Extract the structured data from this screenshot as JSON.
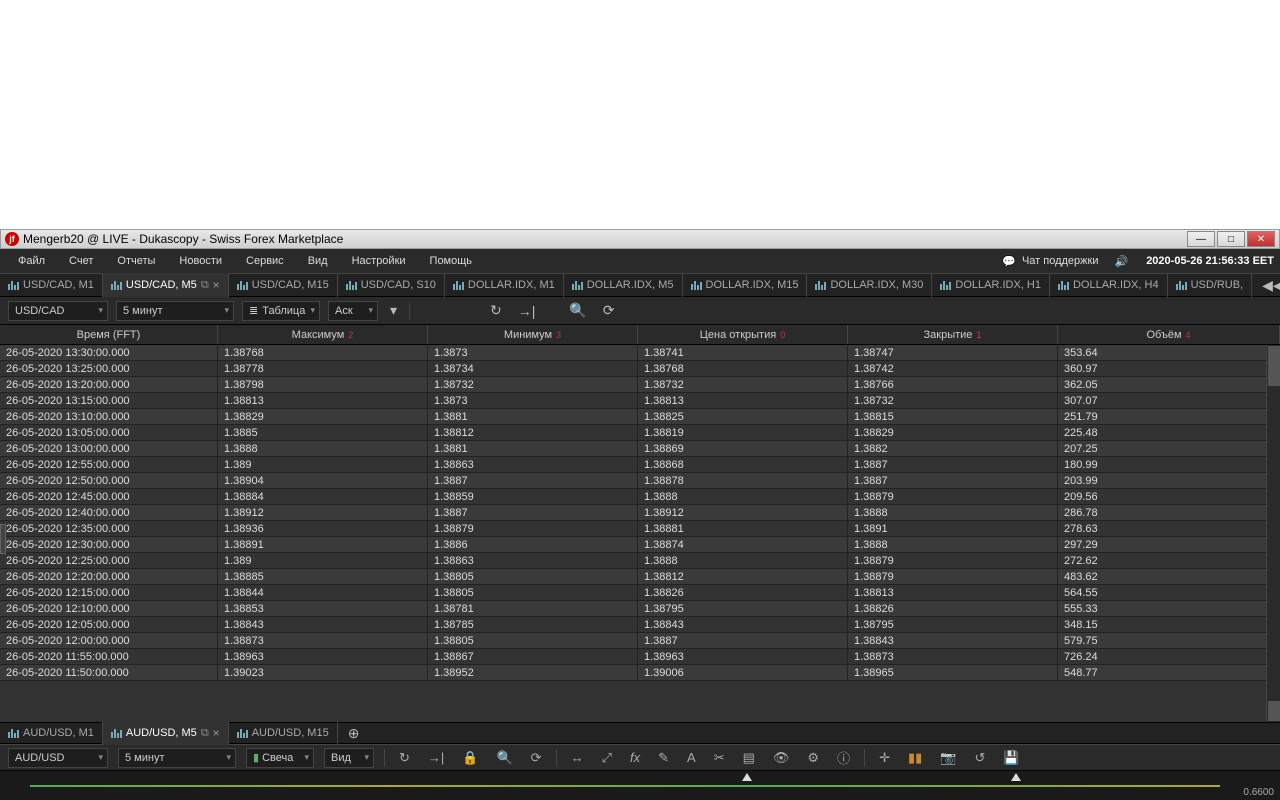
{
  "window": {
    "title": "Mengerb20 @ LIVE - Dukascopy - Swiss Forex Marketplace"
  },
  "menubar": {
    "items": [
      "Файл",
      "Счет",
      "Отчеты",
      "Новости",
      "Сервис",
      "Вид",
      "Настройки",
      "Помощь"
    ],
    "chat": "Чат поддержки",
    "clock": "2020-05-26 21:56:33 EET"
  },
  "tabs_top": [
    {
      "label": "USD/CAD, M1",
      "active": false,
      "icon": false
    },
    {
      "label": "USD/CAD, M5",
      "active": true,
      "icon": true,
      "closable": true
    },
    {
      "label": "USD/CAD, M15",
      "active": false,
      "icon": false
    },
    {
      "label": "USD/CAD, S10",
      "active": false,
      "icon": false
    },
    {
      "label": "DOLLAR.IDX, M1",
      "active": false,
      "icon": false
    },
    {
      "label": "DOLLAR.IDX, M5",
      "active": false,
      "icon": false
    },
    {
      "label": "DOLLAR.IDX, M15",
      "active": false,
      "icon": false
    },
    {
      "label": "DOLLAR.IDX, M30",
      "active": false,
      "icon": false
    },
    {
      "label": "DOLLAR.IDX, H1",
      "active": false,
      "icon": false
    },
    {
      "label": "DOLLAR.IDX, H4",
      "active": false,
      "icon": false
    },
    {
      "label": "USD/RUB,",
      "active": false,
      "icon": false
    }
  ],
  "toolbar_top": {
    "instrument": "USD/CAD",
    "period": "5 минут",
    "view": "Таблица",
    "side": "Аск"
  },
  "table": {
    "headers": {
      "time": "Время (FFT)",
      "high": "Максимум",
      "low": "Минимум",
      "open": "Цена открытия",
      "close": "Закрытие",
      "vol": "Объём"
    },
    "sort": {
      "high": "2",
      "low": "3",
      "open": "0",
      "close": "1",
      "vol": "4"
    },
    "rows": [
      {
        "time": "26-05-2020 13:30:00.000",
        "high": "1.38768",
        "low": "1.3873",
        "open": "1.38741",
        "close": "1.38747",
        "vol": "353.64"
      },
      {
        "time": "26-05-2020 13:25:00.000",
        "high": "1.38778",
        "low": "1.38734",
        "open": "1.38768",
        "close": "1.38742",
        "vol": "360.97"
      },
      {
        "time": "26-05-2020 13:20:00.000",
        "high": "1.38798",
        "low": "1.38732",
        "open": "1.38732",
        "close": "1.38766",
        "vol": "362.05"
      },
      {
        "time": "26-05-2020 13:15:00.000",
        "high": "1.38813",
        "low": "1.3873",
        "open": "1.38813",
        "close": "1.38732",
        "vol": "307.07"
      },
      {
        "time": "26-05-2020 13:10:00.000",
        "high": "1.38829",
        "low": "1.3881",
        "open": "1.38825",
        "close": "1.38815",
        "vol": "251.79"
      },
      {
        "time": "26-05-2020 13:05:00.000",
        "high": "1.3885",
        "low": "1.38812",
        "open": "1.38819",
        "close": "1.38829",
        "vol": "225.48"
      },
      {
        "time": "26-05-2020 13:00:00.000",
        "high": "1.3888",
        "low": "1.3881",
        "open": "1.38869",
        "close": "1.3882",
        "vol": "207.25"
      },
      {
        "time": "26-05-2020 12:55:00.000",
        "high": "1.389",
        "low": "1.38863",
        "open": "1.38868",
        "close": "1.3887",
        "vol": "180.99"
      },
      {
        "time": "26-05-2020 12:50:00.000",
        "high": "1.38904",
        "low": "1.3887",
        "open": "1.38878",
        "close": "1.3887",
        "vol": "203.99"
      },
      {
        "time": "26-05-2020 12:45:00.000",
        "high": "1.38884",
        "low": "1.38859",
        "open": "1.3888",
        "close": "1.38879",
        "vol": "209.56"
      },
      {
        "time": "26-05-2020 12:40:00.000",
        "high": "1.38912",
        "low": "1.3887",
        "open": "1.38912",
        "close": "1.3888",
        "vol": "286.78"
      },
      {
        "time": "26-05-2020 12:35:00.000",
        "high": "1.38936",
        "low": "1.38879",
        "open": "1.38881",
        "close": "1.3891",
        "vol": "278.63"
      },
      {
        "time": "26-05-2020 12:30:00.000",
        "high": "1.38891",
        "low": "1.3886",
        "open": "1.38874",
        "close": "1.3888",
        "vol": "297.29"
      },
      {
        "time": "26-05-2020 12:25:00.000",
        "high": "1.389",
        "low": "1.38863",
        "open": "1.3888",
        "close": "1.38879",
        "vol": "272.62"
      },
      {
        "time": "26-05-2020 12:20:00.000",
        "high": "1.38885",
        "low": "1.38805",
        "open": "1.38812",
        "close": "1.38879",
        "vol": "483.62"
      },
      {
        "time": "26-05-2020 12:15:00.000",
        "high": "1.38844",
        "low": "1.38805",
        "open": "1.38826",
        "close": "1.38813",
        "vol": "564.55"
      },
      {
        "time": "26-05-2020 12:10:00.000",
        "high": "1.38853",
        "low": "1.38781",
        "open": "1.38795",
        "close": "1.38826",
        "vol": "555.33"
      },
      {
        "time": "26-05-2020 12:05:00.000",
        "high": "1.38843",
        "low": "1.38785",
        "open": "1.38843",
        "close": "1.38795",
        "vol": "348.15"
      },
      {
        "time": "26-05-2020 12:00:00.000",
        "high": "1.38873",
        "low": "1.38805",
        "open": "1.3887",
        "close": "1.38843",
        "vol": "579.75"
      },
      {
        "time": "26-05-2020 11:55:00.000",
        "high": "1.38963",
        "low": "1.38867",
        "open": "1.38963",
        "close": "1.38873",
        "vol": "726.24"
      },
      {
        "time": "26-05-2020 11:50:00.000",
        "high": "1.39023",
        "low": "1.38952",
        "open": "1.39006",
        "close": "1.38965",
        "vol": "548.77"
      }
    ]
  },
  "tabs_bottom": [
    {
      "label": "AUD/USD, M1",
      "active": false
    },
    {
      "label": "AUD/USD, M5",
      "active": true
    },
    {
      "label": "AUD/USD, M15",
      "active": false
    }
  ],
  "toolbar_bottom": {
    "instrument": "AUD/USD",
    "period": "5 минут",
    "view": "Свеча",
    "side": "Вид"
  },
  "chart": {
    "ylabel": "0.6600"
  }
}
